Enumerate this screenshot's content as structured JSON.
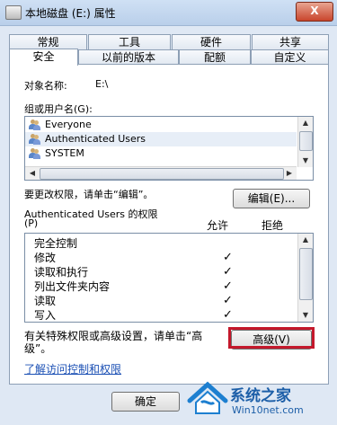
{
  "window": {
    "title": "本地磁盘 (E:) 属性",
    "close_label": "X"
  },
  "tabs": {
    "row1": [
      "常规",
      "工具",
      "硬件",
      "共享"
    ],
    "row2": [
      "安全",
      "以前的版本",
      "配额",
      "自定义"
    ],
    "active": "安全"
  },
  "object": {
    "label": "对象名称:",
    "value": "E:\\"
  },
  "groups": {
    "label": "组或用户名(G):",
    "items": [
      "Everyone",
      "Authenticated Users",
      "SYSTEM"
    ],
    "selected": "Authenticated Users"
  },
  "change_text": "要更改权限，请单击“编辑”。",
  "edit_button": "编辑(E)...",
  "permissions": {
    "title": "Authenticated Users 的权限",
    "title_suffix": "(P)",
    "col_allow": "允许",
    "col_deny": "拒绝",
    "rows": [
      "完全控制",
      "修改",
      "读取和执行",
      "列出文件夹内容",
      "读取",
      "写入"
    ],
    "allow_check": "✓"
  },
  "advanced_text_1": "有关特殊权限或高级设置，请单击“高",
  "advanced_text_2": "级”。",
  "advanced_button": "高级(V)",
  "link_text": "了解访问控制和权限",
  "ok_button": "确定",
  "watermark": {
    "line1": "系统之家",
    "line2": "Win10net.com"
  }
}
